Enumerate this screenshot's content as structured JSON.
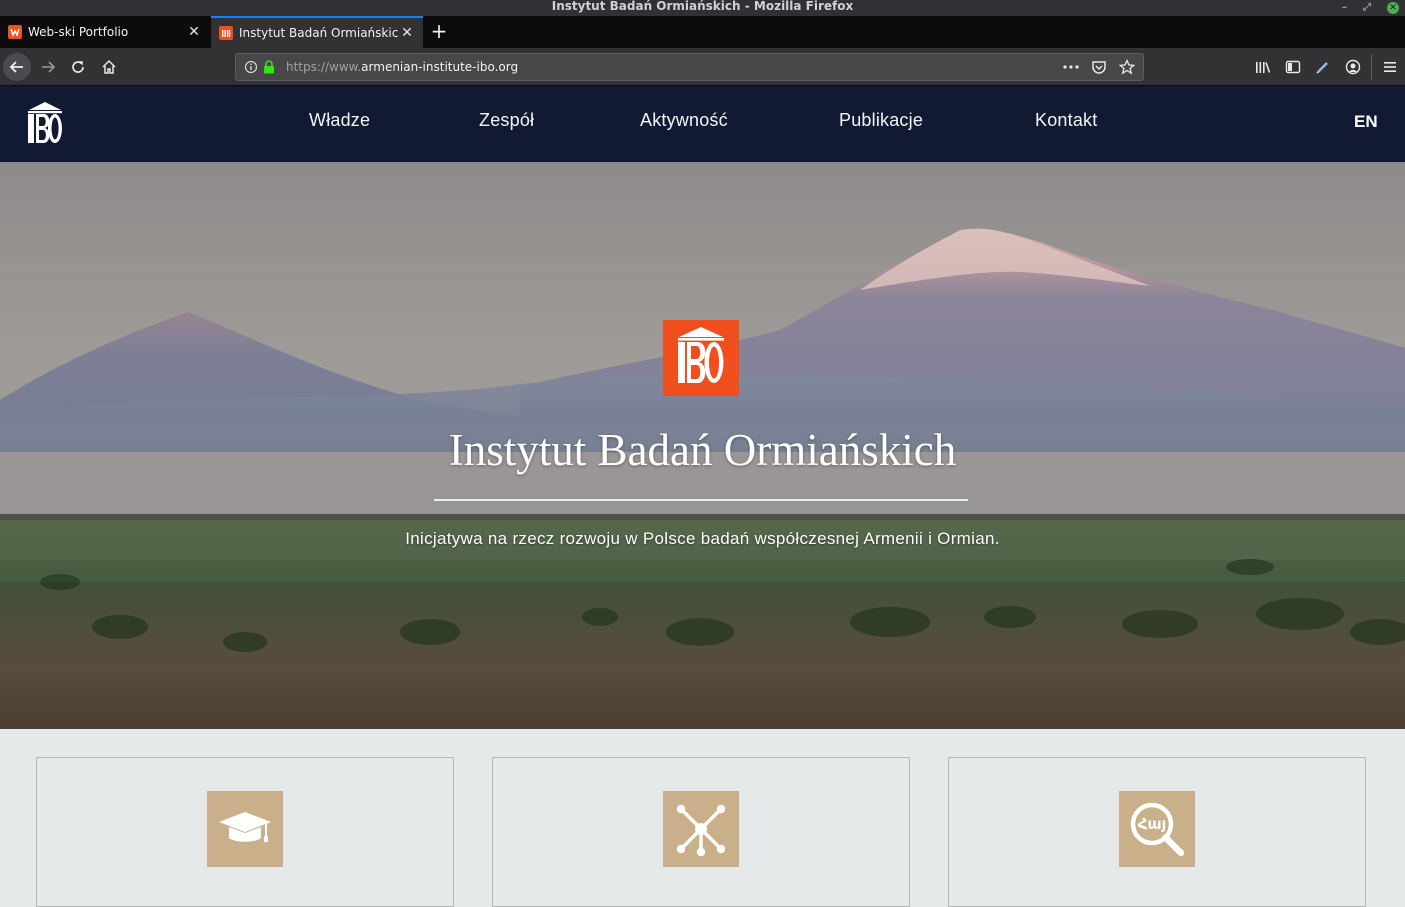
{
  "window": {
    "title": "Instytut Badań Ormiańskich - Mozilla Firefox",
    "controls": [
      "–",
      "⤢",
      "✕"
    ]
  },
  "tabs": [
    {
      "label": "Web-ski Portfolio",
      "favicon": "web-ski-favicon",
      "active": false
    },
    {
      "label": "Instytut Badań Ormiańskich",
      "favicon": "ibo-favicon",
      "active": true
    }
  ],
  "toolbar": {
    "url_prefix": "https://www.",
    "url_domain": "armenian-institute-ibo.org",
    "page_actions": [
      "more-icon",
      "pocket-icon",
      "bookmark-star-icon"
    ],
    "right_icons": [
      "library-icon",
      "sidebar-icon",
      "pen-icon",
      "account-icon",
      "menu-icon"
    ]
  },
  "site": {
    "logo_text": "IBO",
    "menu": [
      "Władze",
      "Zespół",
      "Aktywność",
      "Publikacje",
      "Kontakt"
    ],
    "lang": "EN"
  },
  "hero": {
    "logo_text": "IBO",
    "title": "Instytut Badań Ormiańskich",
    "subtitle": "Inicjatywa na rzecz rozwoju w Polsce badań współczesnej Armenii i Ormian."
  },
  "cards": [
    {
      "icon": "graduation-cap-icon"
    },
    {
      "icon": "network-icon"
    },
    {
      "icon": "armenian-search-icon",
      "icon_text": "Հայ"
    }
  ],
  "colors": {
    "site_nav": "#121a33",
    "logo_orange": "#f04e1c",
    "card_icon_bg": "#c9b08a",
    "page_bg": "#e6e9ea",
    "tab_accent": "#0a84ff"
  }
}
